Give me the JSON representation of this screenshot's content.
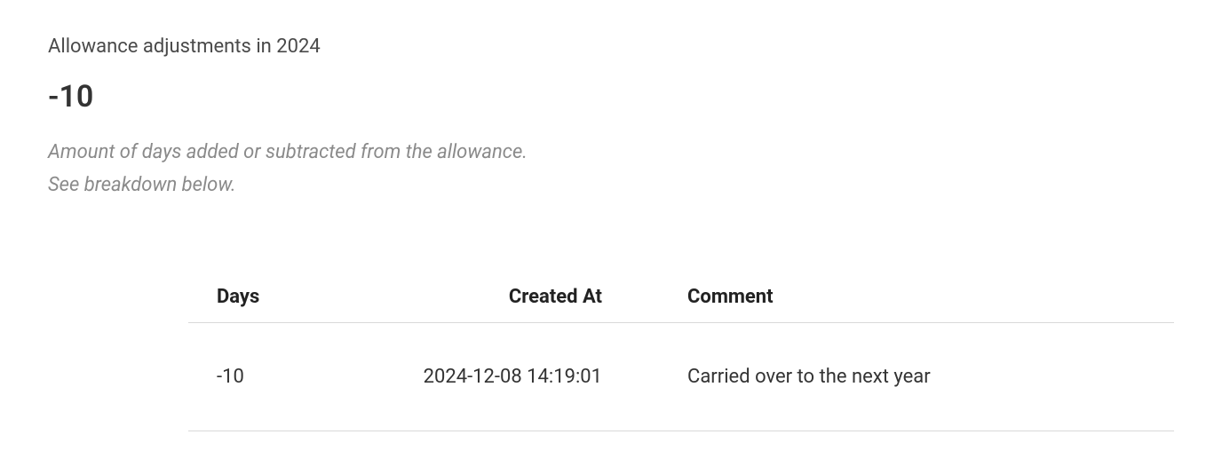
{
  "section": {
    "title": "Allowance adjustments in 2024",
    "summary_value": "-10",
    "description_line1": "Amount of days added or subtracted from the allowance.",
    "description_line2": "See breakdown below."
  },
  "table": {
    "headers": {
      "days": "Days",
      "created_at": "Created At",
      "comment": "Comment"
    },
    "rows": [
      {
        "days": "-10",
        "created_at": "2024-12-08 14:19:01",
        "comment": "Carried over to the next year"
      }
    ]
  }
}
